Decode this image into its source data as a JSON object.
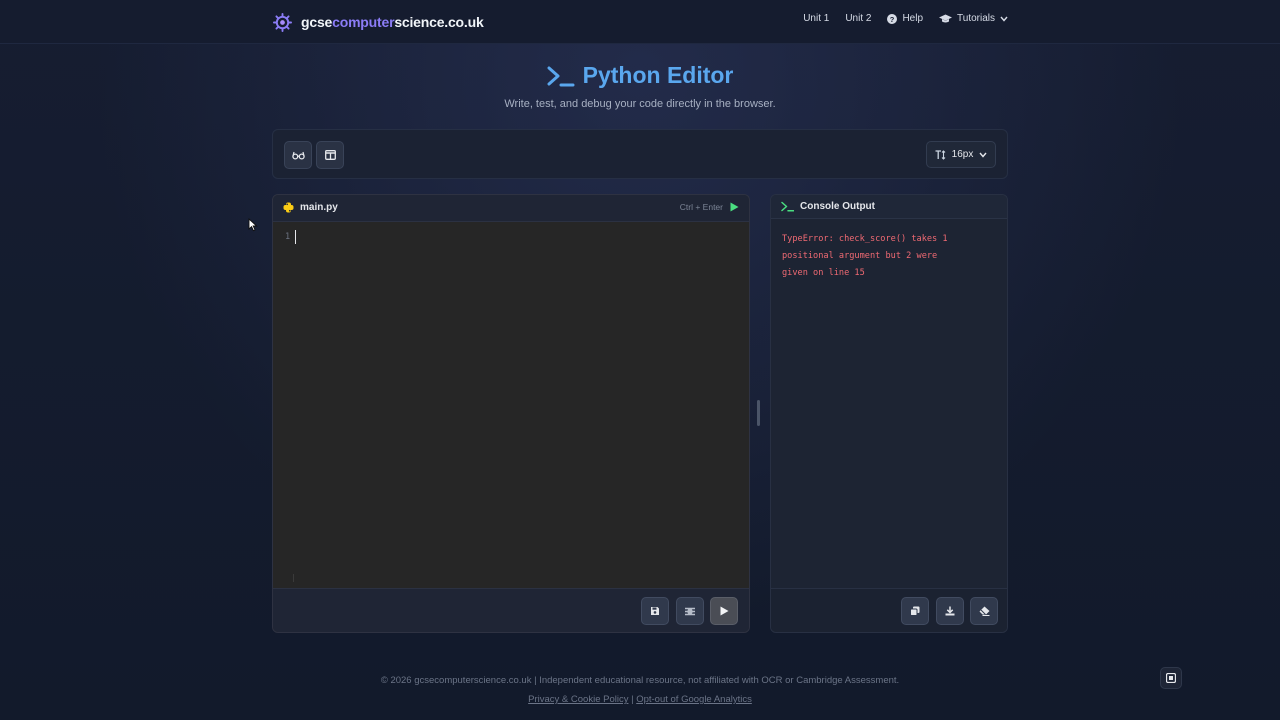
{
  "site": {
    "logo_prefix": "gcse",
    "logo_highlight": "computer",
    "logo_suffix": "science.co.uk"
  },
  "nav": {
    "unit1": "Unit 1",
    "unit2": "Unit 2",
    "help": "Help",
    "tutorials": "Tutorials"
  },
  "hero": {
    "title": "Python Editor",
    "subtitle": "Write, test, and debug your code directly in the browser."
  },
  "toolbar": {
    "font_size": "16px"
  },
  "editor": {
    "filename": "main.py",
    "shortcut_hint": "Ctrl + Enter",
    "line_number": "1",
    "code": ""
  },
  "console": {
    "title": "Console Output",
    "output": "TypeError: check_score() takes 1\npositional argument but 2 were\ngiven on line 15"
  },
  "footer": {
    "copyright": "© 2026 gcsecomputerscience.co.uk | Independent educational resource, not affiliated with OCR or Cambridge Assessment.",
    "privacy_link": "Privacy & Cookie Policy",
    "separator": "|",
    "optout_link": "Opt-out of Google Analytics"
  },
  "colors": {
    "accent": "#5aa7ee",
    "logo_purple": "#8b7cf6",
    "error": "#f06a73",
    "run_green": "#4ade80"
  },
  "icons": {
    "logo": "gear-brain-icon",
    "help": "question-circle-icon",
    "tutorials": "graduation-cap-icon",
    "terminal": "terminal-prompt-icon"
  }
}
